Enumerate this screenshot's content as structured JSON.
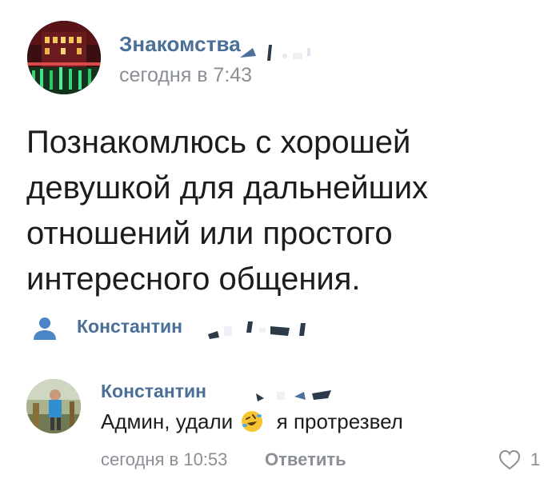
{
  "post": {
    "group_name": "Знакомства",
    "time": "сегодня в 7:43",
    "text": "Познакомлюсь с хорошей девушкой для дальнейших отношений или простого интересного общения.",
    "author": "Константин",
    "author_icon": "person-icon"
  },
  "comment": {
    "author": "Константин",
    "text_before": "Админ, удали",
    "emoji": "rolling-on-floor-laughing-emoji",
    "text_after": "я протрезвел",
    "time": "сегодня в 10:53",
    "reply_label": "Ответить",
    "like_icon": "heart-outline-icon",
    "like_count": "1"
  },
  "colors": {
    "link": "#4a6f98",
    "secondary": "#8a8f96",
    "text": "#1c1c1c"
  }
}
